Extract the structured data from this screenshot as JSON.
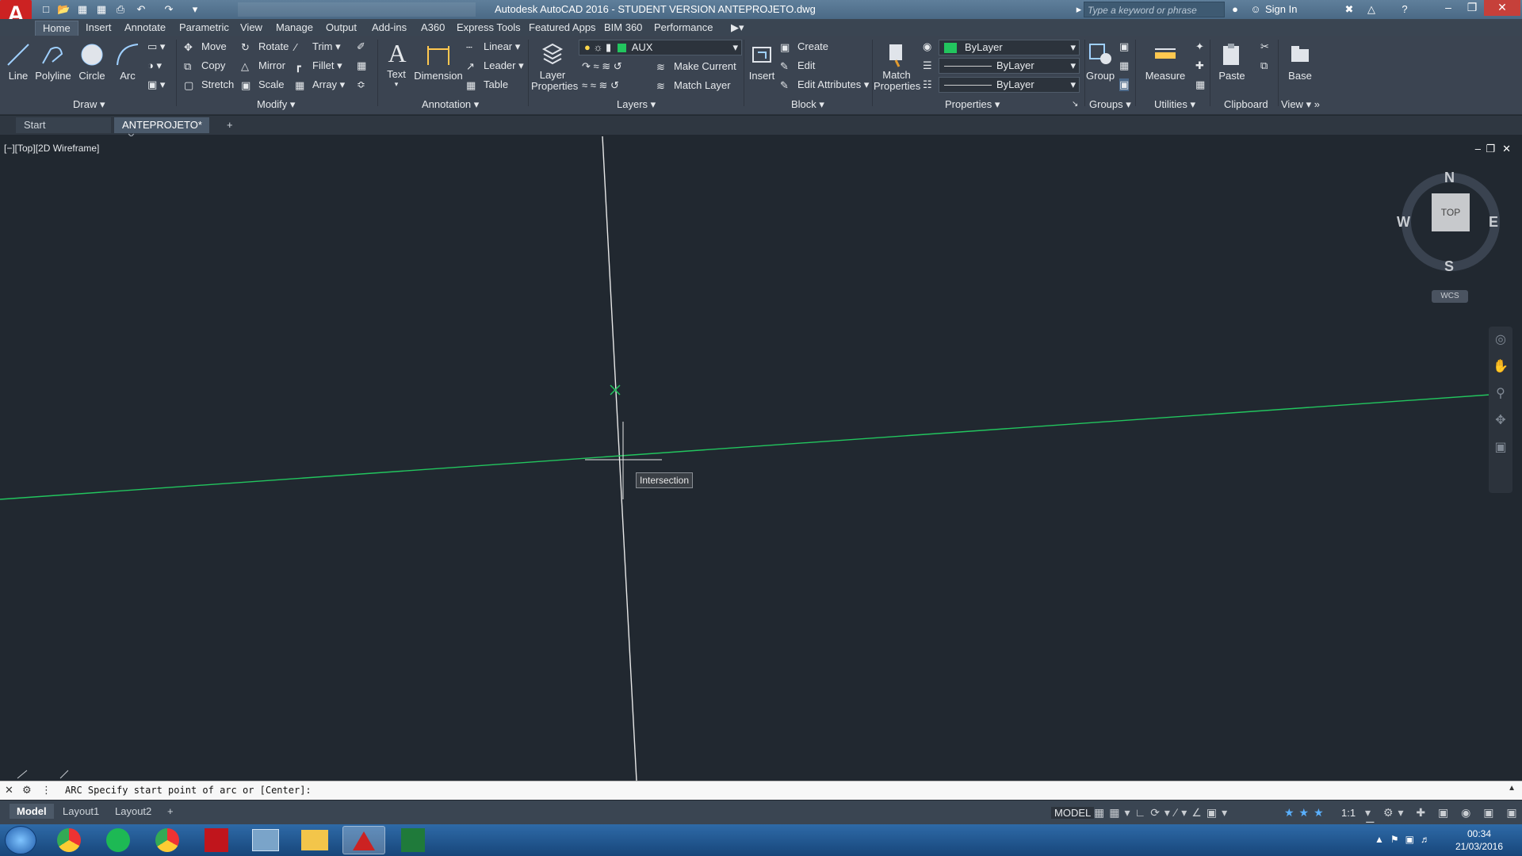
{
  "title_bar": {
    "title": "Autodesk AutoCAD 2016 - STUDENT VERSION    ANTEPROJETO.dwg",
    "search_placeholder": "Type a keyword or phrase",
    "sign_in": "Sign In",
    "app_logo": "A"
  },
  "ribbon_tabs": [
    "Home",
    "Insert",
    "Annotate",
    "Parametric",
    "View",
    "Manage",
    "Output",
    "Add-ins",
    "A360",
    "Express Tools",
    "Featured Apps",
    "BIM 360",
    "Performance"
  ],
  "ribbon": {
    "draw": {
      "title": "Draw",
      "line": "Line",
      "polyline": "Polyline",
      "circle": "Circle",
      "arc": "Arc"
    },
    "modify": {
      "title": "Modify",
      "move": "Move",
      "rotate": "Rotate",
      "trim": "Trim",
      "copy": "Copy",
      "mirror": "Mirror",
      "fillet": "Fillet",
      "stretch": "Stretch",
      "scale": "Scale",
      "array": "Array"
    },
    "annotation": {
      "title": "Annotation",
      "text": "Text",
      "dimension": "Dimension",
      "linear": "Linear",
      "leader": "Leader",
      "table": "Table"
    },
    "layers": {
      "title": "Layers",
      "layer_properties_1": "Layer",
      "layer_properties_2": "Properties",
      "current_layer": "AUX",
      "make_current": "Make Current",
      "match_layer": "Match Layer"
    },
    "block": {
      "title": "Block",
      "insert": "Insert",
      "create": "Create",
      "edit": "Edit",
      "edit_attributes": "Edit Attributes"
    },
    "properties": {
      "title": "Properties",
      "match_1": "Match",
      "match_2": "Properties",
      "color": "ByLayer",
      "linetype": "ByLayer",
      "lineweight": "ByLayer"
    },
    "groups": {
      "title": "Groups",
      "group": "Group"
    },
    "utilities": {
      "title": "Utilities",
      "measure": "Measure"
    },
    "clipboard": {
      "title": "Clipboard",
      "paste": "Paste"
    },
    "view": {
      "title": "View",
      "base": "Base"
    }
  },
  "file_tabs": {
    "start": "Start",
    "active": "ANTEPROJETO*"
  },
  "viewport": {
    "label": "[−][Top][2D Wireframe]",
    "tooltip": "Intersection",
    "viewcube": {
      "n": "N",
      "s": "S",
      "e": "E",
      "w": "W",
      "face": "TOP",
      "ucs": "WCS"
    }
  },
  "command_line": {
    "prompt": "ARC Specify start point of arc or [Center]:"
  },
  "layout_tabs": [
    "Model",
    "Layout1",
    "Layout2"
  ],
  "status_bar": {
    "model": "MODEL",
    "scale": "1:1"
  },
  "taskbar": {
    "time": "00:34",
    "date": "21/03/2016"
  },
  "colors": {
    "accent_green": "#22c55e",
    "drawing_line_white": "#e8e8e8",
    "background": "#212830"
  }
}
